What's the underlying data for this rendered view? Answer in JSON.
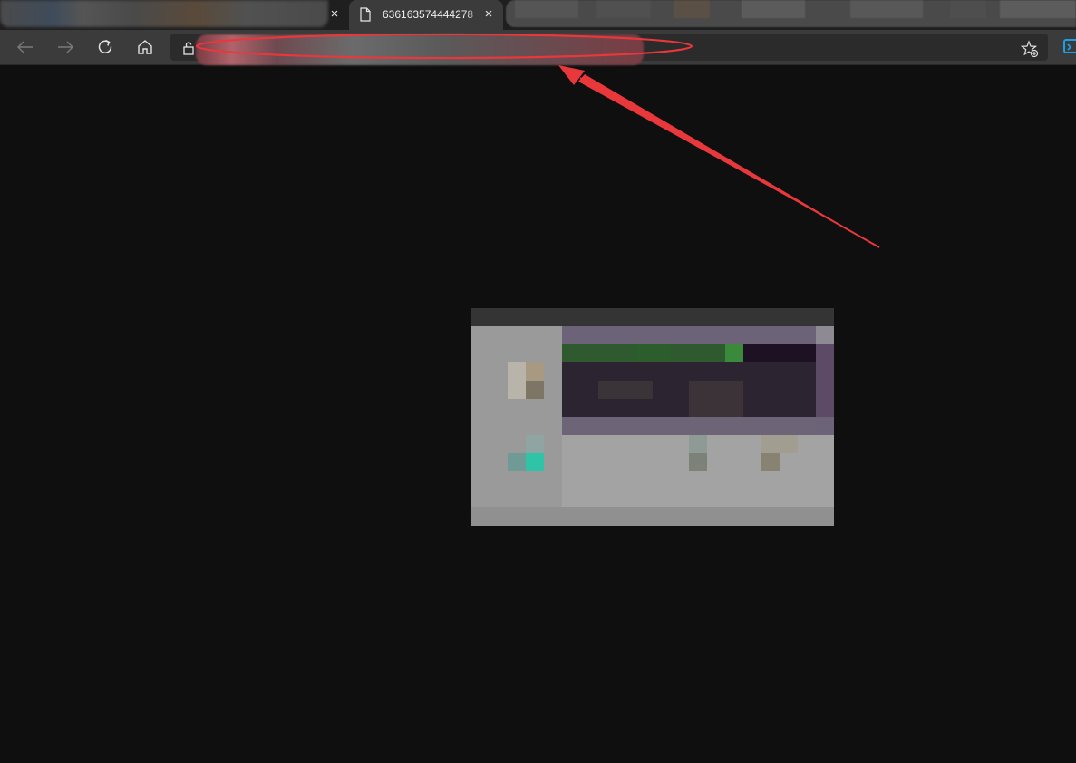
{
  "browser": {
    "active_tab": {
      "title": "636163574444278",
      "close_glyph": "×",
      "icon": "document-icon"
    },
    "inactive_tab_close_glyph": "×",
    "toolbar": {
      "icons": [
        "back-arrow-icon",
        "forward-arrow-icon",
        "refresh-icon",
        "home-icon",
        "lock-icon",
        "favorite-star-icon",
        "extension-icon"
      ]
    },
    "address_bar": {
      "state": "redacted"
    }
  },
  "colors": {
    "page_background": "#0f0f0f",
    "annotation_red": "#e8383b",
    "extension_accent": "#1a9ee8"
  }
}
